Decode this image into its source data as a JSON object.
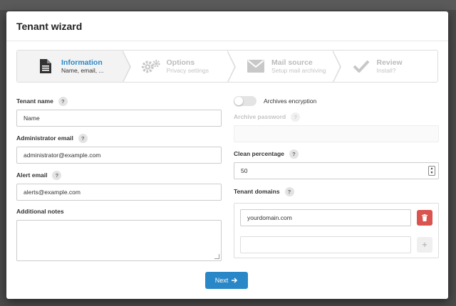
{
  "modal": {
    "title": "Tenant wizard"
  },
  "steps": [
    {
      "title": "Information",
      "subtitle": "Name, email, ...",
      "icon": "document-icon",
      "active": true
    },
    {
      "title": "Options",
      "subtitle": "Privacy settings",
      "icon": "gears-icon",
      "active": false
    },
    {
      "title": "Mail source",
      "subtitle": "Setup mail archiving",
      "icon": "envelope-icon",
      "active": false
    },
    {
      "title": "Review",
      "subtitle": "Install?",
      "icon": "check-icon",
      "active": false
    }
  ],
  "form": {
    "tenant_name": {
      "label": "Tenant name",
      "value": "Name"
    },
    "admin_email": {
      "label": "Administrator email",
      "value": "administrator@example.com"
    },
    "alert_email": {
      "label": "Alert email",
      "value": "alerts@example.com"
    },
    "notes": {
      "label": "Additional notes",
      "value": ""
    },
    "encryption": {
      "label": "Archives encryption",
      "enabled": false
    },
    "archive_password": {
      "label": "Archive password",
      "value": ""
    },
    "clean_percentage": {
      "label": "Clean percentage",
      "value": "50"
    },
    "tenant_domains": {
      "label": "Tenant domains",
      "items": [
        "yourdomain.com",
        ""
      ]
    }
  },
  "help_glyph": "?",
  "buttons": {
    "next": "Next",
    "add": "+"
  },
  "colors": {
    "accent": "#2a87c7",
    "danger": "#d9534f"
  }
}
